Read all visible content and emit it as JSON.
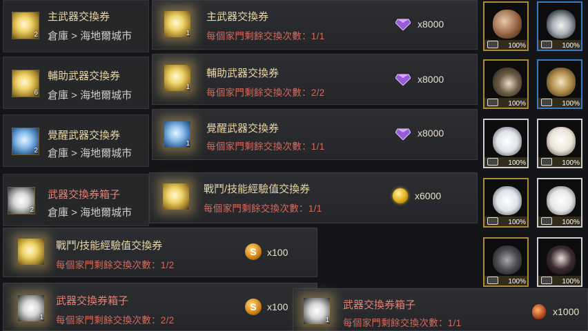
{
  "inventory": [
    {
      "title": "主武器交換券",
      "location": "倉庫 > 海地爾城市",
      "count": "2",
      "style": "gold"
    },
    {
      "title": "輔助武器交換券",
      "location": "倉庫 > 海地爾城市",
      "count": "6",
      "style": "gold"
    },
    {
      "title": "覺醒武器交換券",
      "location": "倉庫 > 海地爾城市",
      "count": "2",
      "style": "blue"
    },
    {
      "title": "武器交換券箱子",
      "location": "倉庫 > 海地爾城市",
      "count": "2",
      "style": "chest"
    }
  ],
  "exchange": [
    {
      "title": "主武器交換券",
      "limit": "每個家門剩餘交換次數：1/1",
      "price": "x8000",
      "count": "1",
      "currency": "purple-gem-icon"
    },
    {
      "title": "輔助武器交換券",
      "limit": "每個家門剩餘交換次數：2/2",
      "price": "x8000",
      "count": "1",
      "currency": "purple-gem-icon"
    },
    {
      "title": "覺醒武器交換券",
      "limit": "每個家門剩餘交換次數：1/1",
      "price": "x8000",
      "count": "1",
      "currency": "purple-gem-icon"
    },
    {
      "title": "戰鬥/技能經驗值交換券",
      "limit": "每個家門剩餘交換次數：1/1",
      "price": "x6000",
      "count": "",
      "currency": "gold-coin-icon"
    },
    {
      "title": "戰鬥/技能經驗值交換券",
      "limit": "每個家門剩餘交換次數：1/2",
      "price": "x100",
      "count": "",
      "currency": "s-coin-icon"
    },
    {
      "title": "武器交換券箱子",
      "limit": "每個家門剩餘交換次數：2/2",
      "price": "x100",
      "count": "1",
      "currency": "s-coin-icon"
    },
    {
      "title": "武器交換券箱子",
      "limit": "每個家門剩餘交換次數：1/1",
      "price": "x1000",
      "count": "1",
      "currency": "potion-icon"
    }
  ],
  "pets": [
    {
      "name": "fox-pet",
      "percent": "100%"
    },
    {
      "name": "penguin-pet",
      "percent": "100%"
    },
    {
      "name": "hedgehog-pet",
      "percent": "100%"
    },
    {
      "name": "chick-pet",
      "percent": "100%"
    },
    {
      "name": "polar-bear-pet",
      "percent": "100%"
    },
    {
      "name": "alpaca-pet",
      "percent": "100%"
    },
    {
      "name": "polar-bear-pet",
      "percent": "100%"
    },
    {
      "name": "rabbit-pet",
      "percent": "100%"
    },
    {
      "name": "raccoon-pet",
      "percent": "100%"
    },
    {
      "name": "dog-pet",
      "percent": "100%"
    }
  ],
  "colors": {
    "gold_text": "#e8d7a8",
    "red_text": "#d36a5e",
    "pet_border": "#b08a34",
    "pet_border_blue": "#3a7bc8"
  }
}
